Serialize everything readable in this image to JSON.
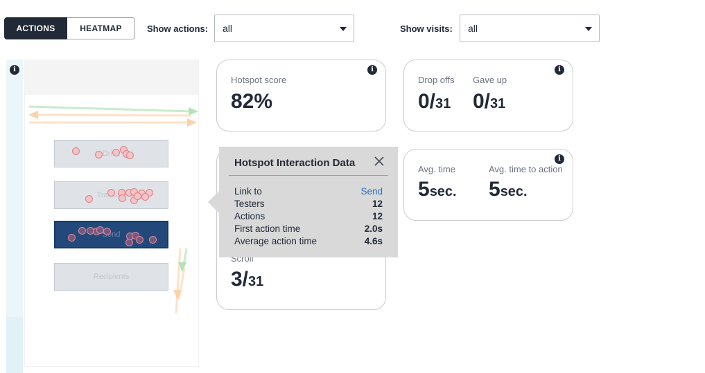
{
  "toolbar": {
    "tabs": [
      {
        "label": "ACTIONS",
        "active": true
      },
      {
        "label": "HEATMAP",
        "active": false
      }
    ],
    "show_actions_label": "Show actions:",
    "show_actions_value": "all",
    "show_visits_label": "Show visits:",
    "show_visits_value": "all"
  },
  "preview": {
    "buttons": [
      {
        "label": "Drive"
      },
      {
        "label": "Tracking"
      },
      {
        "label": "Send"
      },
      {
        "label": "Recipients"
      }
    ]
  },
  "cards": {
    "hotspot": {
      "label": "Hotspot score",
      "value": "82%"
    },
    "drop_offs": {
      "label": "Drop offs",
      "num": "0/",
      "den": "31"
    },
    "gave_up": {
      "label": "Gave up",
      "num": "0/",
      "den": "31"
    },
    "avg_time": {
      "label": "Avg. time",
      "num": "5",
      "unit": "sec."
    },
    "avg_time_action": {
      "label": "Avg. time to action",
      "num": "5",
      "unit": "sec."
    },
    "scroll": {
      "label": "Scroll",
      "num": "3/",
      "den": "31"
    }
  },
  "tooltip": {
    "title": "Hotspot Interaction Data",
    "rows": [
      {
        "label": "Link to",
        "value": "Send"
      },
      {
        "label": "Testers",
        "value": "12"
      },
      {
        "label": "Actions",
        "value": "12"
      },
      {
        "label": "First action time",
        "value": "2.0s"
      },
      {
        "label": "Average action time",
        "value": "4.6s"
      }
    ]
  },
  "colors": {
    "primary_dark": "#222a38",
    "link": "#2a72c8",
    "send_button": "#22497a"
  },
  "icons": [
    "info-icon",
    "close-icon",
    "chevron-down-icon"
  ]
}
